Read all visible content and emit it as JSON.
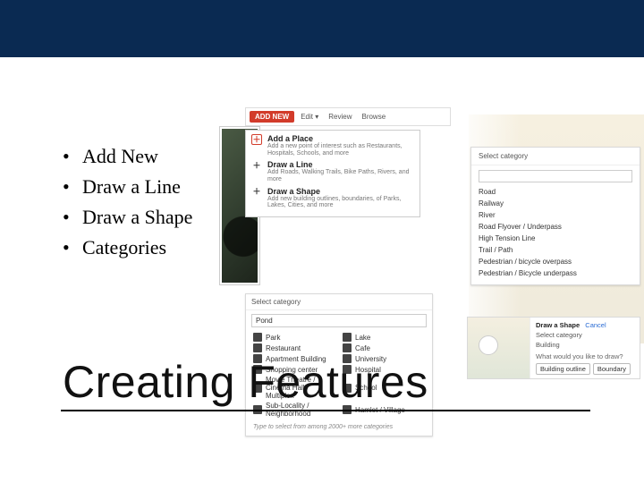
{
  "header_bar": "",
  "bullets": {
    "items": [
      "Add New",
      "Draw a Line",
      "Draw a Shape",
      "Categories"
    ]
  },
  "slide_title": "Creating Features",
  "collage": {
    "toolbar": {
      "addnew": "ADD NEW",
      "items": [
        "Edit ▾",
        "Review",
        "Browse"
      ]
    },
    "addnew_popup": {
      "rows": [
        {
          "title": "Add a Place",
          "desc": "Add a new point of interest such as Restaurants, Hospitals, Schools, and more"
        },
        {
          "title": "Draw a Line",
          "desc": "Add Roads, Walking Trails, Bike Paths, Rivers, and more"
        },
        {
          "title": "Draw a Shape",
          "desc": "Add new building outlines, boundaries, of Parks, Lakes, Cities, and more"
        }
      ]
    },
    "catlist": {
      "title": "Select category",
      "items": [
        "Road",
        "Railway",
        "River",
        "Road Flyover / Underpass",
        "High Tension Line",
        "Trail / Path",
        "Pedestrian / bicycle overpass",
        "Pedestrian / Bicycle underpass"
      ]
    },
    "catgrid": {
      "title": "Select category",
      "value": "Pond",
      "cells_left": [
        "Park",
        "Restaurant",
        "Apartment Building",
        "Shopping center",
        "Movie Theatre / Cinema Hall / Multiplex",
        "Sub-Locality / Neighborhood"
      ],
      "cells_right": [
        "Lake",
        "Cafe",
        "University",
        "Hospital",
        "School",
        "Hamlet / Village"
      ],
      "footer": "Type to select from among 2000+ more categories"
    },
    "shape_panel": {
      "title": "Draw a Shape",
      "cancel": "Cancel",
      "select": "Select category",
      "building": "Building",
      "question": "What would you like to draw?",
      "buttons": [
        "Building outline",
        "Boundary"
      ]
    }
  }
}
